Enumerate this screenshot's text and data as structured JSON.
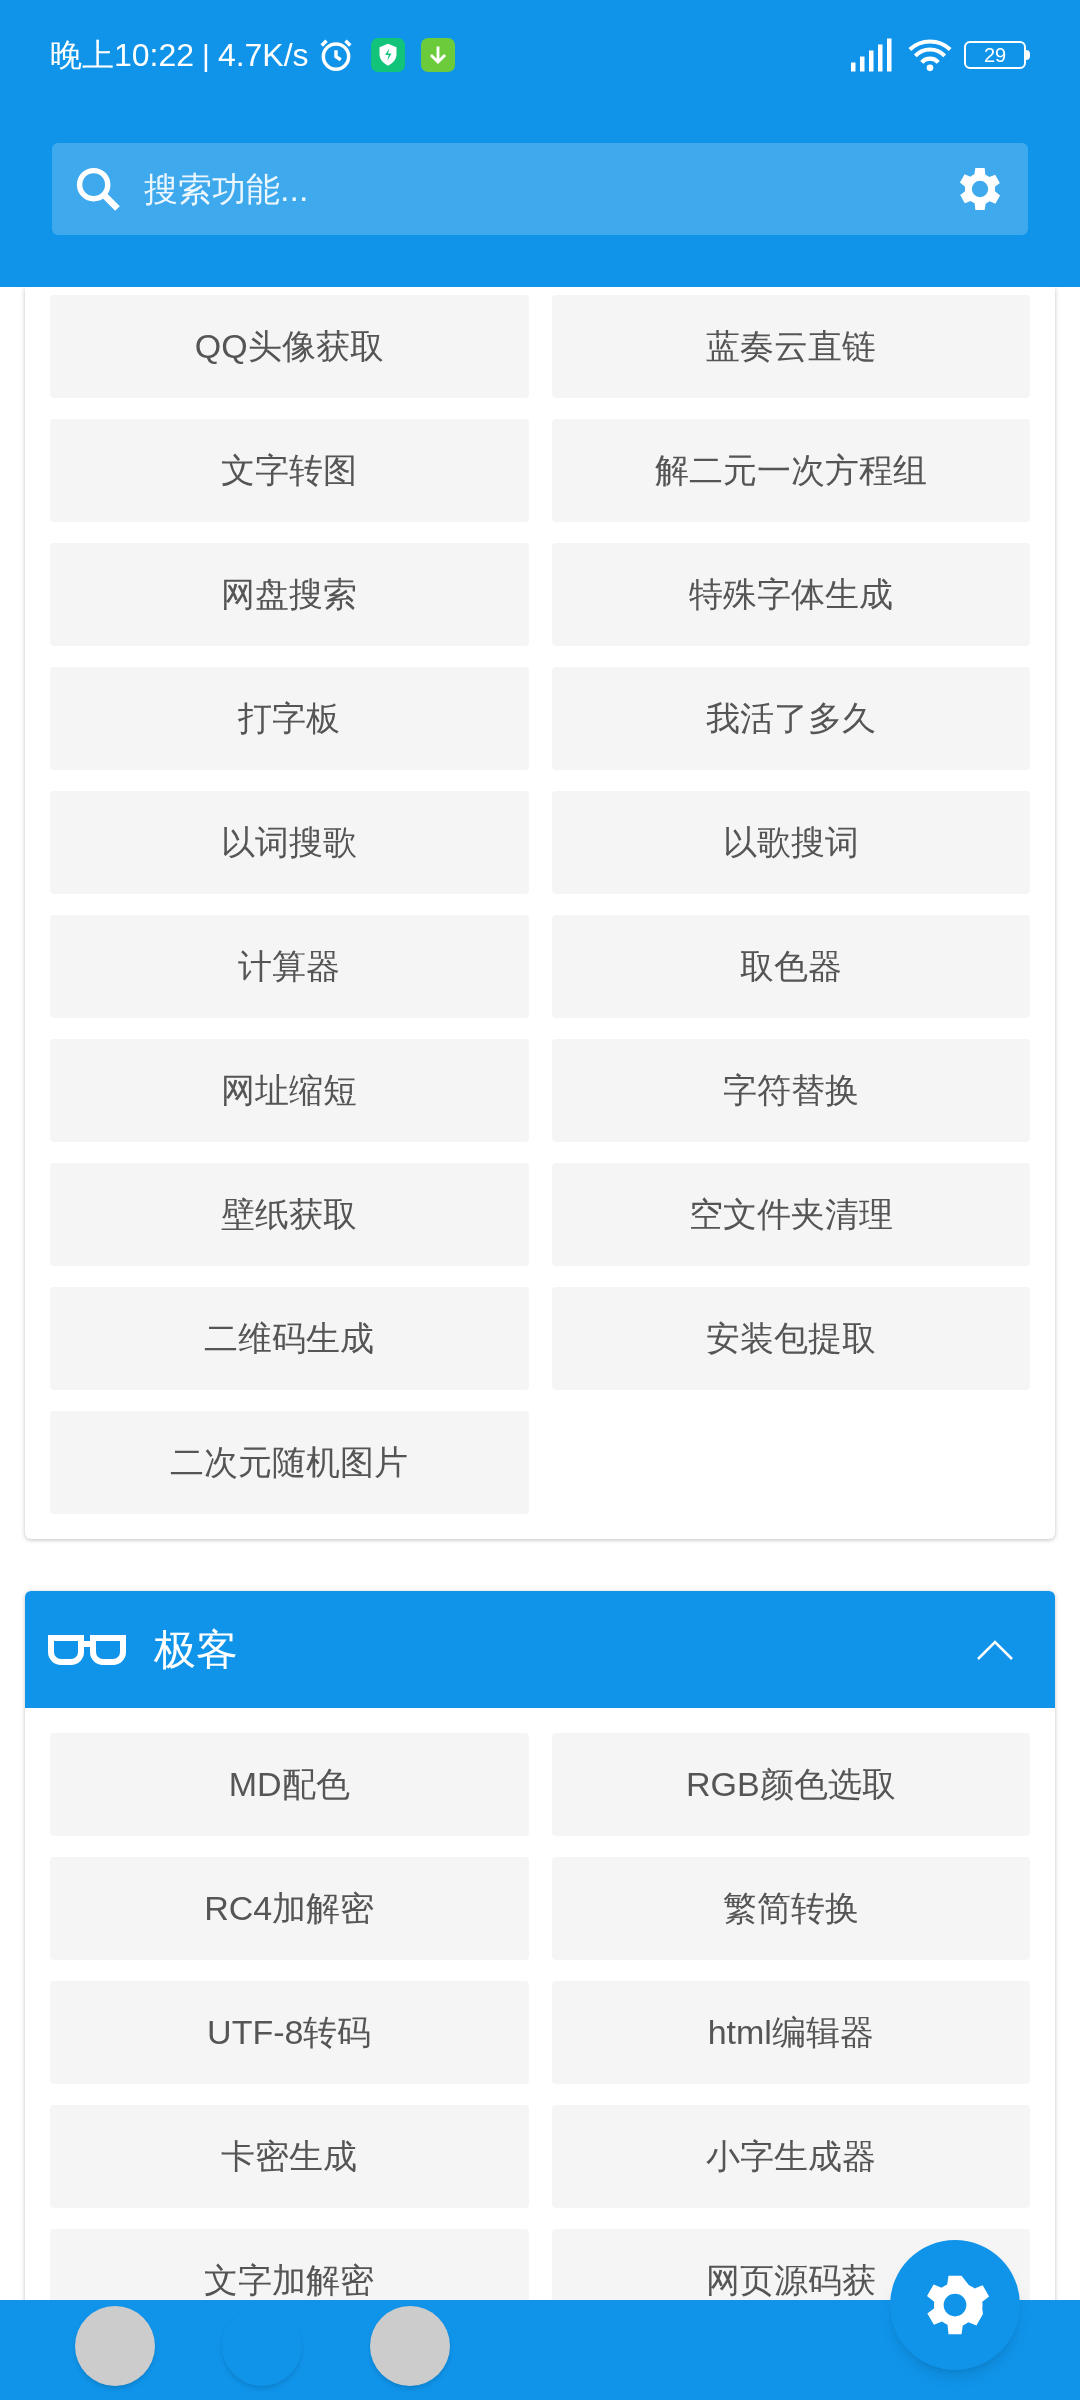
{
  "status_bar": {
    "time": "晚上10:22",
    "separator": "|",
    "speed": "4.7K/s",
    "battery": "29"
  },
  "search": {
    "placeholder": "搜索功能..."
  },
  "sections": [
    {
      "items": [
        "QQ头像获取",
        "蓝奏云直链",
        "文字转图",
        "解二元一次方程组",
        "网盘搜索",
        "特殊字体生成",
        "打字板",
        "我活了多久",
        "以词搜歌",
        "以歌搜词",
        "计算器",
        "取色器",
        "网址缩短",
        "字符替换",
        "壁纸获取",
        "空文件夹清理",
        "二维码生成",
        "安装包提取",
        "二次元随机图片"
      ]
    },
    {
      "title": "极客",
      "expanded": true,
      "items": [
        "MD配色",
        "RGB颜色选取",
        "RC4加解密",
        "繁简转换",
        "UTF-8转码",
        "html编辑器",
        "卡密生成",
        "小字生成器",
        "文字加解密",
        "网页源码获"
      ]
    }
  ],
  "dots": [
    {
      "selected": false
    },
    {
      "selected": true
    },
    {
      "selected": false
    }
  ]
}
